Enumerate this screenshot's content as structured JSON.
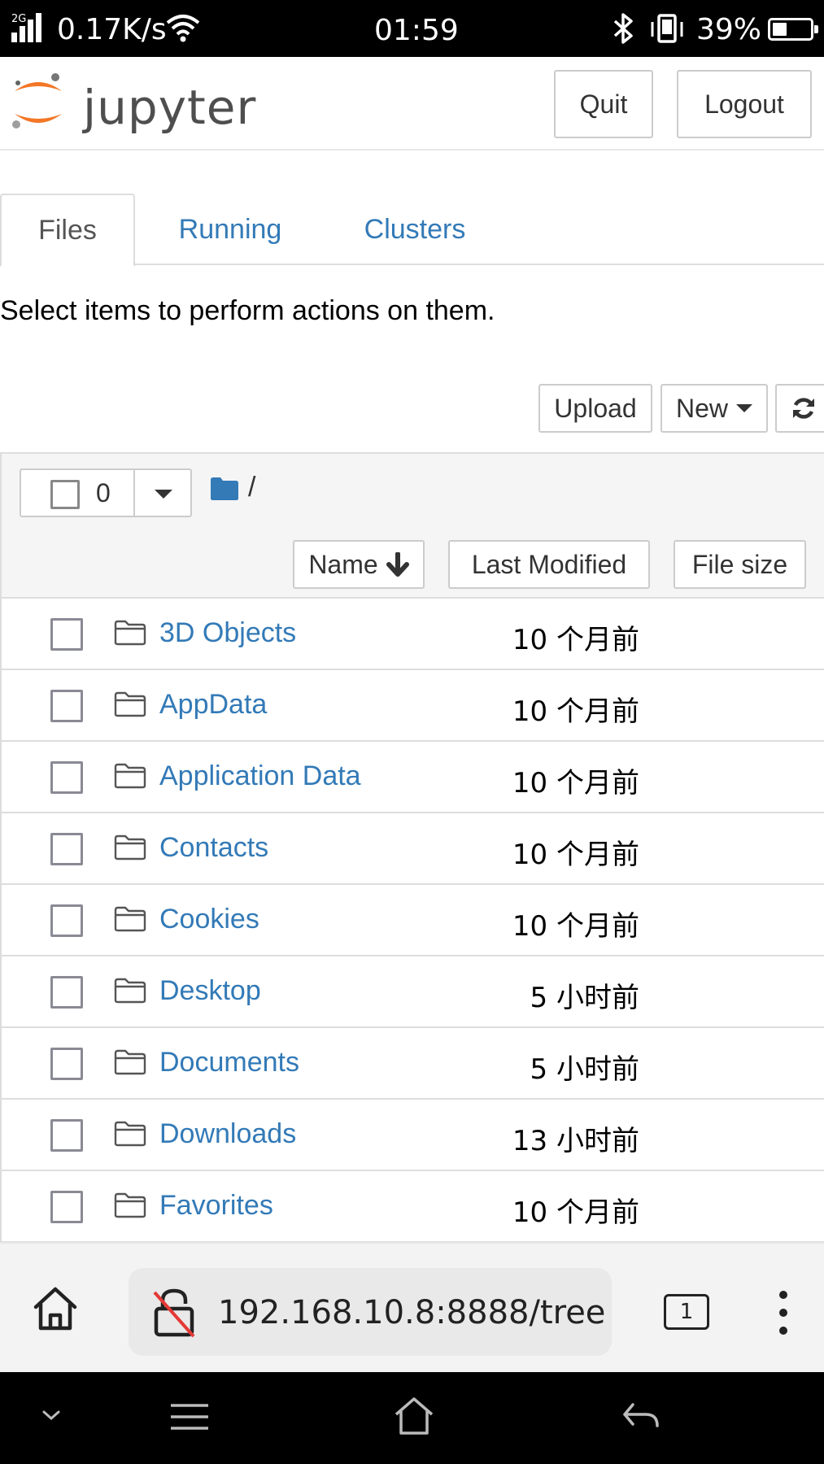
{
  "status_bar": {
    "network_type": "2G",
    "speed": "0.17K/s",
    "time": "01:59",
    "battery_percent": "39%",
    "battery_level": 0.39,
    "icons": [
      "signal-icon",
      "wifi-icon",
      "bluetooth-icon",
      "vibrate-icon",
      "battery-icon"
    ]
  },
  "header": {
    "logo_text": "jupyter",
    "quit_label": "Quit",
    "logout_label": "Logout"
  },
  "tabs": [
    {
      "label": "Files",
      "active": true
    },
    {
      "label": "Running",
      "active": false
    },
    {
      "label": "Clusters",
      "active": false
    }
  ],
  "hint_text": "Select items to perform actions on them.",
  "toolbar": {
    "upload_label": "Upload",
    "new_label": "New",
    "refresh_icon": "refresh-icon"
  },
  "list_header": {
    "selected_count": "0",
    "breadcrumb_separator": "/",
    "sort_name_label": "Name",
    "sort_modified_label": "Last Modified",
    "sort_size_label": "File size"
  },
  "files": [
    {
      "name": "3D Objects",
      "modified": "10 个月前"
    },
    {
      "name": "AppData",
      "modified": "10 个月前"
    },
    {
      "name": "Application Data",
      "modified": "10 个月前"
    },
    {
      "name": "Contacts",
      "modified": "10 个月前"
    },
    {
      "name": "Cookies",
      "modified": "10 个月前"
    },
    {
      "name": "Desktop",
      "modified": "5 小时前"
    },
    {
      "name": "Documents",
      "modified": "5 小时前"
    },
    {
      "name": "Downloads",
      "modified": "13 小时前"
    },
    {
      "name": "Favorites",
      "modified": "10 个月前"
    }
  ],
  "browser": {
    "url": "192.168.10.8:8888/tree",
    "tab_count": "1"
  },
  "colors": {
    "link": "#337ab7",
    "jupyter_orange": "#f37726",
    "panel_bg": "#f5f5f5"
  }
}
